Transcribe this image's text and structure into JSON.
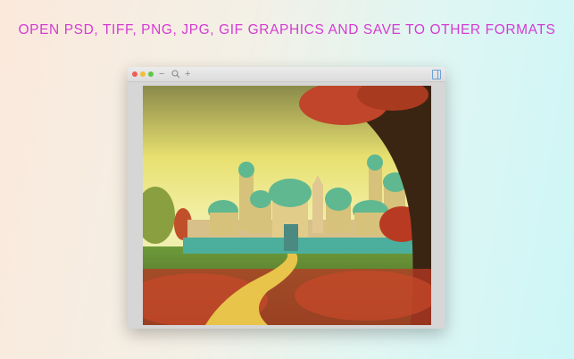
{
  "headline": "OPEN PSD, TIFF, PNG, JPG, GIF GRAPHICS AND SAVE TO OTHER FORMATS",
  "window": {
    "controls": [
      "close",
      "minimize",
      "zoom"
    ],
    "toolbar": {
      "zoom_out_icon": "−",
      "zoom_icon": "magnifier",
      "zoom_in_icon": "+"
    },
    "colors": {
      "close": "#ee5e55",
      "minimize": "#f4bd3a",
      "zoom": "#5fc748",
      "accent": "#d53bd3"
    }
  }
}
